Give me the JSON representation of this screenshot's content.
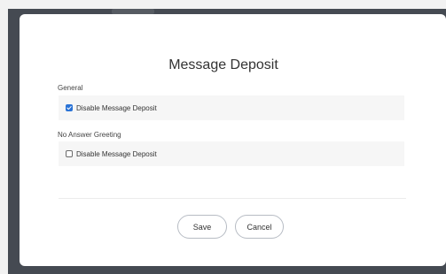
{
  "dialog": {
    "title": "Message Deposit",
    "sections": [
      {
        "label": "General",
        "option_label": "Disable Message Deposit",
        "checked": true
      },
      {
        "label": "No Answer Greeting",
        "option_label": "Disable Message Deposit",
        "checked": false
      }
    ],
    "buttons": {
      "save_label": "Save",
      "cancel_label": "Cancel"
    }
  },
  "colors": {
    "backdrop": "#454a52",
    "accent": "#2a73d6",
    "row_background": "#f6f6f6"
  }
}
